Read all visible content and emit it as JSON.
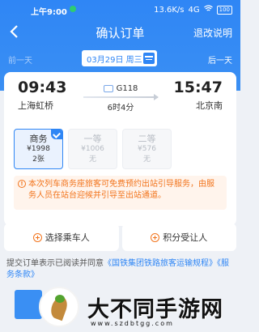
{
  "status_bar": {
    "time": "上午9:00",
    "speed": "13.6K/s",
    "signal": "4G",
    "battery": "100"
  },
  "nav": {
    "title": "确认订单",
    "help": "退改说明"
  },
  "date_row": {
    "prev": "前一天",
    "date": "03月29日 周三",
    "next": "后一天"
  },
  "trip": {
    "depart_time": "09:43",
    "depart_station": "上海虹桥",
    "train": "G118",
    "duration": "6时4分",
    "arrive_time": "15:47",
    "arrive_station": "北京南"
  },
  "seats": [
    {
      "name": "商务",
      "price": "¥1998",
      "availability": "2张",
      "selected": true
    },
    {
      "name": "一等",
      "price": "¥1006",
      "availability": "无",
      "selected": false
    },
    {
      "name": "二等",
      "price": "¥576",
      "availability": "无",
      "selected": false
    }
  ],
  "notice": "本次列车商务座旅客可免费预约出站引导服务，由服务人员在站台迎候并引导至出站通道。",
  "actions": {
    "select_passenger": "选择乘车人",
    "points_recipient": "积分受让人"
  },
  "agreement": {
    "prefix": "提交订单表示已阅读并同意",
    "rules_link": "《国铁集团铁路旅客运输规程》",
    "terms_link": "《服务条款》"
  },
  "watermark": {
    "brand": "大不同手游网",
    "site": "www.szdbtgg.com"
  },
  "colors": {
    "primary": "#2f86f5",
    "warning": "#f2741c"
  }
}
